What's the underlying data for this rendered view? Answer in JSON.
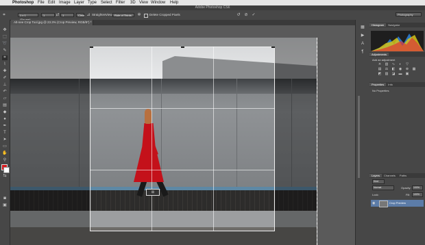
{
  "menubar": {
    "app": "Photoshop",
    "items": [
      "File",
      "Edit",
      "Image",
      "Layer",
      "Type",
      "Select",
      "Filter",
      "3D",
      "View",
      "Window",
      "Help"
    ]
  },
  "titlebar": {
    "title": "Adobe Photoshop CS6"
  },
  "options": {
    "ratio": "1 x 1 (Square)",
    "w": "1",
    "h": "1",
    "clear": "Clear",
    "straighten": "Straighten",
    "view_label": "View:",
    "view_value": "Rule of Thirds",
    "delete_cropped": "Delete Cropped Pixels",
    "workspace": "Photography"
  },
  "document": {
    "tab_title": "Alt-nee Crop Tool.jpg @ 23.3% (Crop Preview, RGB/8*) *"
  },
  "panels": {
    "histogram_tabs": [
      "Histogram",
      "Navigator"
    ],
    "adjustments_title": "Adjustments",
    "adjustments_subtitle": "Add an adjustment",
    "properties_tabs": [
      "Properties",
      "Info"
    ],
    "properties_text": "No Properties",
    "layers_tabs": [
      "Layers",
      "Channels",
      "Paths"
    ],
    "layers_kind": "Kind",
    "blend_mode": "Normal",
    "opacity_label": "Opacity:",
    "opacity_value": "100%",
    "lock_label": "Lock:",
    "fill_label": "Fill:",
    "fill_value": "100%",
    "layer_name": "Crop Preview"
  },
  "colors": {
    "foreground": "#d6191d",
    "background": "#ffffff",
    "accent": "#5c7ca8"
  }
}
